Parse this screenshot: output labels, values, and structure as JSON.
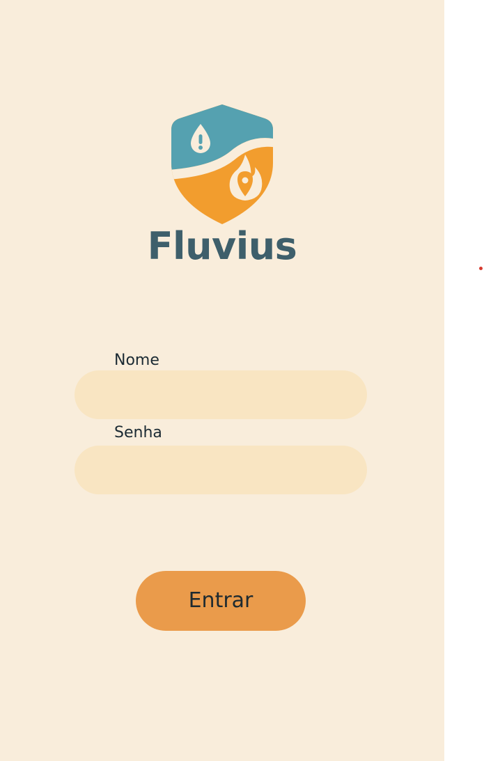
{
  "app": {
    "brand_name": "Fluvius"
  },
  "login_form": {
    "name_label": "Nome",
    "name_value": "",
    "password_label": "Senha",
    "password_value": "",
    "submit_label": "Entrar"
  },
  "colors": {
    "background": "#f9eddb",
    "field": "#f9e5c2",
    "button": "#ea9b4b",
    "brand_text": "#3e5f6b",
    "logo_teal": "#55a1b0",
    "logo_orange": "#f29d2e"
  },
  "icons": {
    "logo": "shield-water-fire-icon"
  }
}
